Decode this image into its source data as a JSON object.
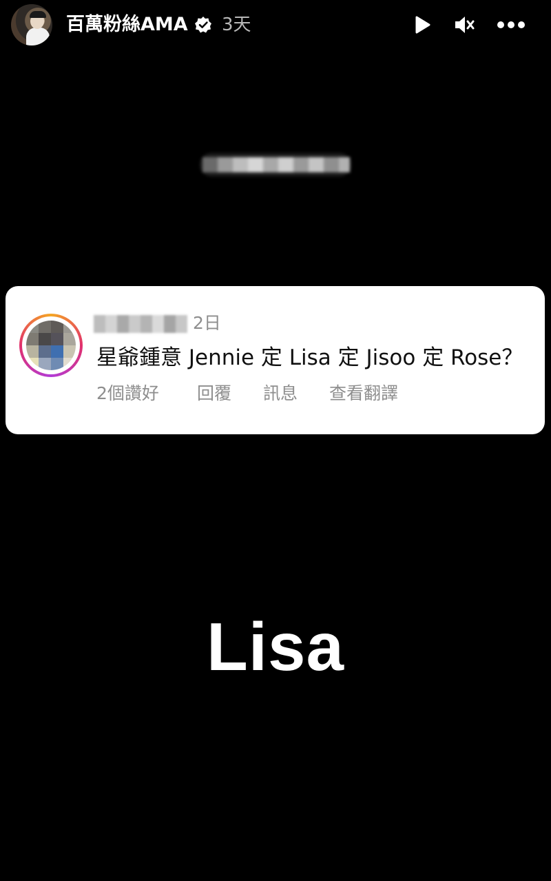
{
  "header": {
    "account_name": "百萬粉絲AMA",
    "post_age": "3天",
    "icons": {
      "avatar": "profile-photo",
      "verified": "verified-badge-icon",
      "play": "play-icon",
      "mute": "speaker-muted-icon",
      "more": "more-horizontal-icon"
    }
  },
  "comment": {
    "time": "2日",
    "text": "星爺鍾意 Jennie 定 Lisa 定 Jisoo 定 Rose？",
    "actions": {
      "likes": "2個讚好",
      "reply": "回覆",
      "message": "訊息",
      "translate": "查看翻譯"
    }
  },
  "answer": "Lisa",
  "colors": {
    "background": "#000000",
    "card": "#ffffff",
    "muted_text": "#8e8e8e",
    "ring_start": "#f5a623",
    "ring_mid": "#e1306c",
    "ring_end": "#b23bd6"
  }
}
